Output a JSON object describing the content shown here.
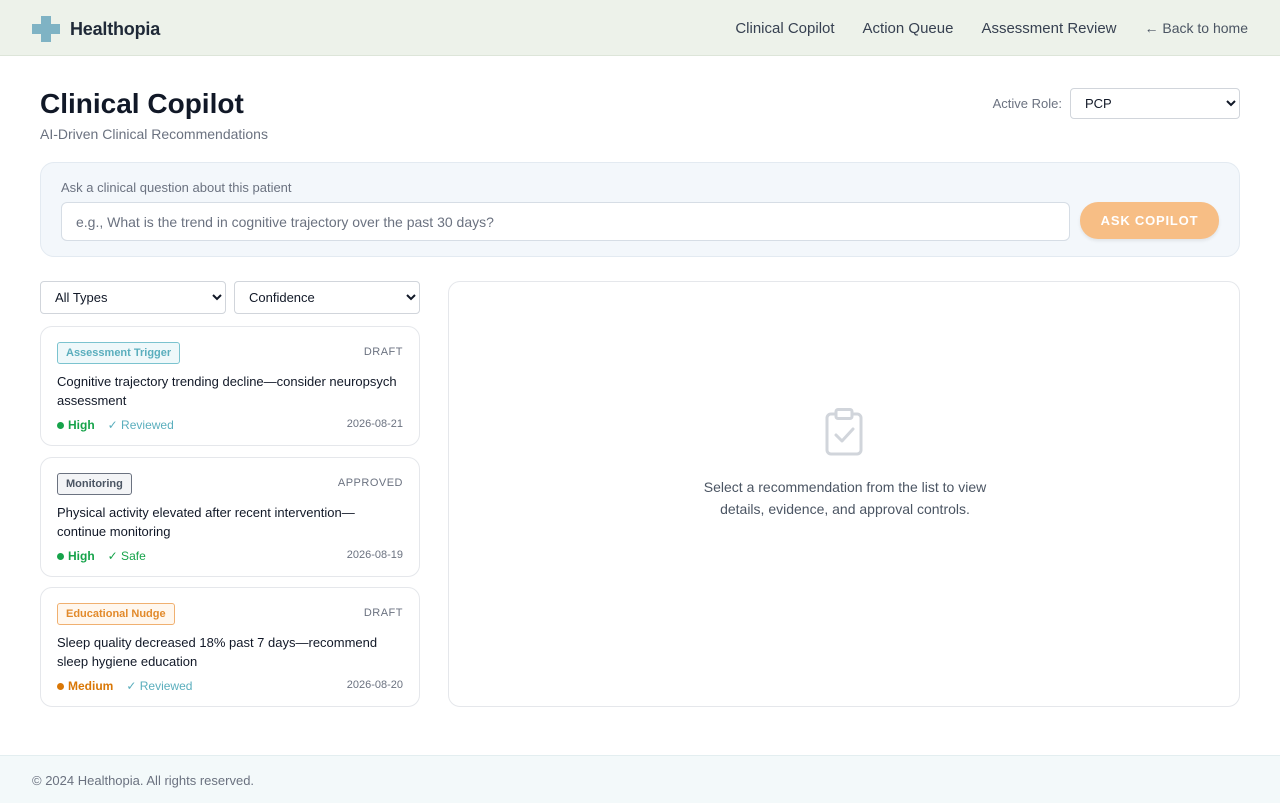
{
  "brand": {
    "name": "Healthopia",
    "color": "#7fb3c4"
  },
  "nav": {
    "items": [
      "Clinical Copilot",
      "Action Queue",
      "Assessment Review"
    ],
    "back_label": "← Back to home"
  },
  "header": {
    "title": "Clinical Copilot",
    "subtitle": "AI-Driven Clinical Recommendations",
    "role_label": "Active Role:",
    "role_value": "PCP"
  },
  "ask": {
    "label": "Ask a clinical question about this patient",
    "placeholder": "e.g., What is the trend in cognitive trajectory over the past 30 days?",
    "button": "ASK COPILOT",
    "button_color": "#f7be85"
  },
  "filters": {
    "type_value": "All Types",
    "confidence_value": "Confidence"
  },
  "recommendations": [
    {
      "tag": "Assessment Trigger",
      "status": "DRAFT",
      "title": "Cognitive trajectory trending decline—consider neuropsych assessment",
      "confidence": "High",
      "confidence_color": "#16a34a",
      "flag": "✓ Reviewed",
      "date": "2026-08-21"
    },
    {
      "tag": "Monitoring",
      "status": "APPROVED",
      "title": "Physical activity elevated after recent intervention—continue monitoring",
      "confidence": "High",
      "confidence_color": "#16a34a",
      "flag": "✓ Safe",
      "date": "2026-08-19"
    },
    {
      "tag": "Educational Nudge",
      "status": "DRAFT",
      "title": "Sleep quality decreased 18% past 7 days—recommend sleep hygiene education",
      "confidence": "Medium",
      "confidence_color": "#d97706",
      "flag": "✓ Reviewed",
      "date": "2026-08-20"
    }
  ],
  "detail": {
    "icon": "clipboard-check-icon",
    "empty_text": "Select a recommendation from the list to view details, evidence, and approval controls."
  },
  "footer": {
    "text": "© 2024 Healthopia. All rights reserved."
  }
}
